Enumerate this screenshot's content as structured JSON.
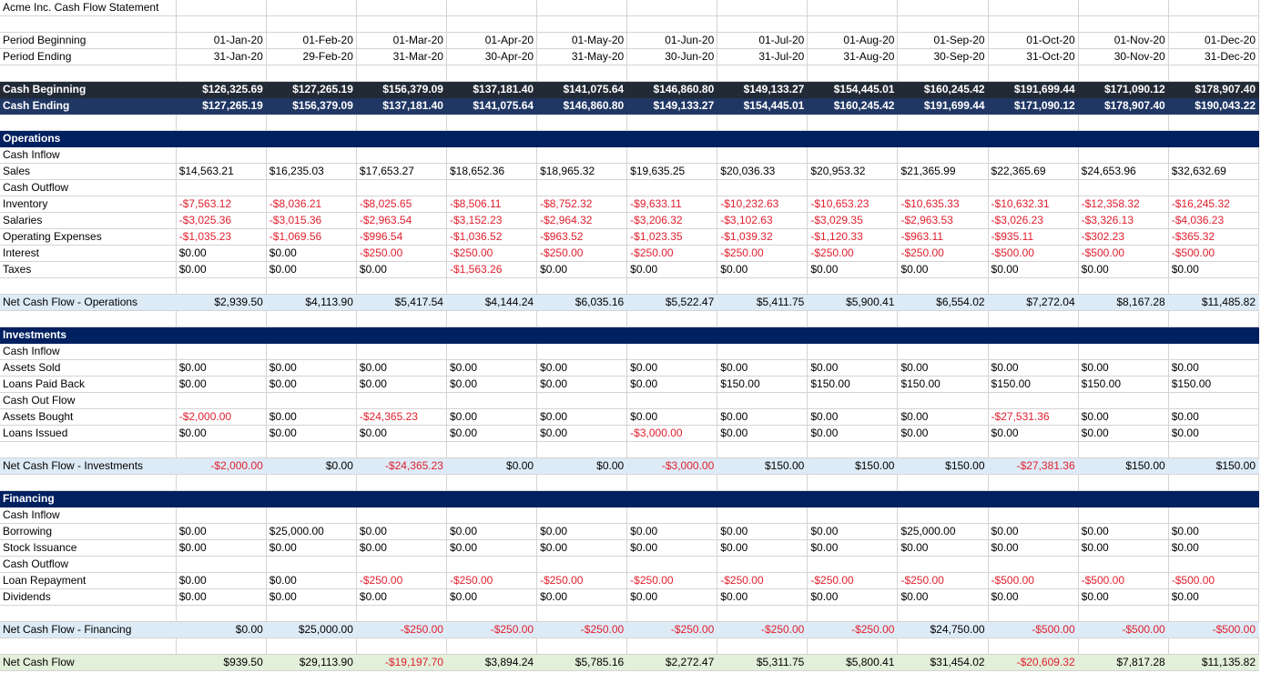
{
  "title": "Acme Inc. Cash Flow Statement",
  "period_beginning_label": "Period Beginning",
  "period_ending_label": "Period Ending",
  "period_beginning": [
    "01-Jan-20",
    "01-Feb-20",
    "01-Mar-20",
    "01-Apr-20",
    "01-May-20",
    "01-Jun-20",
    "01-Jul-20",
    "01-Aug-20",
    "01-Sep-20",
    "01-Oct-20",
    "01-Nov-20",
    "01-Dec-20"
  ],
  "period_ending": [
    "31-Jan-20",
    "29-Feb-20",
    "31-Mar-20",
    "30-Apr-20",
    "31-May-20",
    "30-Jun-20",
    "31-Jul-20",
    "31-Aug-20",
    "30-Sep-20",
    "31-Oct-20",
    "30-Nov-20",
    "31-Dec-20"
  ],
  "cash_beginning": {
    "label": "Cash Beginning",
    "values": [
      "$126,325.69",
      "$127,265.19",
      "$156,379.09",
      "$137,181.40",
      "$141,075.64",
      "$146,860.80",
      "$149,133.27",
      "$154,445.01",
      "$160,245.42",
      "$191,699.44",
      "$171,090.12",
      "$178,907.40"
    ]
  },
  "cash_ending": {
    "label": "Cash Ending",
    "values": [
      "$127,265.19",
      "$156,379.09",
      "$137,181.40",
      "$141,075.64",
      "$146,860.80",
      "$149,133.27",
      "$154,445.01",
      "$160,245.42",
      "$191,699.44",
      "$171,090.12",
      "$178,907.40",
      "$190,043.22"
    ]
  },
  "sections": [
    {
      "name": "Operations",
      "groups": [
        {
          "label": "Cash Inflow",
          "items": [
            {
              "label": "Sales",
              "values": [
                "$14,563.21",
                "$16,235.03",
                "$17,653.27",
                "$18,652.36",
                "$18,965.32",
                "$19,635.25",
                "$20,036.33",
                "$20,953.32",
                "$21,365.99",
                "$22,365.69",
                "$24,653.96",
                "$32,632.69"
              ]
            }
          ]
        },
        {
          "label": "Cash Outflow",
          "items": [
            {
              "label": "Inventory",
              "values": [
                "-$7,563.12",
                "-$8,036.21",
                "-$8,025.65",
                "-$8,506.11",
                "-$8,752.32",
                "-$9,633.11",
                "-$10,232.63",
                "-$10,653.23",
                "-$10,635.33",
                "-$10,632.31",
                "-$12,358.32",
                "-$16,245.32"
              ]
            },
            {
              "label": "Salaries",
              "values": [
                "-$3,025.36",
                "-$3,015.36",
                "-$2,963.54",
                "-$3,152.23",
                "-$2,964.32",
                "-$3,206.32",
                "-$3,102.63",
                "-$3,029.35",
                "-$2,963.53",
                "-$3,026.23",
                "-$3,326.13",
                "-$4,036.23"
              ]
            },
            {
              "label": "Operating Expenses",
              "values": [
                "-$1,035.23",
                "-$1,069.56",
                "-$996.54",
                "-$1,036.52",
                "-$963.52",
                "-$1,023.35",
                "-$1,039.32",
                "-$1,120.33",
                "-$963.11",
                "-$935.11",
                "-$302.23",
                "-$365.32"
              ]
            },
            {
              "label": "Interest",
              "values": [
                "$0.00",
                "$0.00",
                "-$250.00",
                "-$250.00",
                "-$250.00",
                "-$250.00",
                "-$250.00",
                "-$250.00",
                "-$250.00",
                "-$500.00",
                "-$500.00",
                "-$500.00"
              ]
            },
            {
              "label": "Taxes",
              "values": [
                "$0.00",
                "$0.00",
                "$0.00",
                "-$1,563.26",
                "$0.00",
                "$0.00",
                "$0.00",
                "$0.00",
                "$0.00",
                "$0.00",
                "$0.00",
                "$0.00"
              ]
            }
          ]
        }
      ],
      "net": {
        "label": "Net Cash Flow - Operations",
        "values": [
          "$2,939.50",
          "$4,113.90",
          "$5,417.54",
          "$4,144.24",
          "$6,035.16",
          "$5,522.47",
          "$5,411.75",
          "$5,900.41",
          "$6,554.02",
          "$7,272.04",
          "$8,167.28",
          "$11,485.82"
        ]
      }
    },
    {
      "name": "Investments",
      "groups": [
        {
          "label": "Cash Inflow",
          "items": [
            {
              "label": "Assets Sold",
              "values": [
                "$0.00",
                "$0.00",
                "$0.00",
                "$0.00",
                "$0.00",
                "$0.00",
                "$0.00",
                "$0.00",
                "$0.00",
                "$0.00",
                "$0.00",
                "$0.00"
              ]
            },
            {
              "label": "Loans Paid Back",
              "values": [
                "$0.00",
                "$0.00",
                "$0.00",
                "$0.00",
                "$0.00",
                "$0.00",
                "$150.00",
                "$150.00",
                "$150.00",
                "$150.00",
                "$150.00",
                "$150.00"
              ]
            }
          ]
        },
        {
          "label": "Cash Out Flow",
          "items": [
            {
              "label": "Assets Bought",
              "values": [
                "-$2,000.00",
                "$0.00",
                "-$24,365.23",
                "$0.00",
                "$0.00",
                "$0.00",
                "$0.00",
                "$0.00",
                "$0.00",
                "-$27,531.36",
                "$0.00",
                "$0.00"
              ]
            },
            {
              "label": "Loans Issued",
              "values": [
                "$0.00",
                "$0.00",
                "$0.00",
                "$0.00",
                "$0.00",
                "-$3,000.00",
                "$0.00",
                "$0.00",
                "$0.00",
                "$0.00",
                "$0.00",
                "$0.00"
              ]
            }
          ]
        }
      ],
      "net": {
        "label": "Net Cash Flow - Investments",
        "values": [
          "-$2,000.00",
          "$0.00",
          "-$24,365.23",
          "$0.00",
          "$0.00",
          "-$3,000.00",
          "$150.00",
          "$150.00",
          "$150.00",
          "-$27,381.36",
          "$150.00",
          "$150.00"
        ]
      }
    },
    {
      "name": "Financing",
      "groups": [
        {
          "label": "Cash Inflow",
          "items": [
            {
              "label": "Borrowing",
              "values": [
                "$0.00",
                "$25,000.00",
                "$0.00",
                "$0.00",
                "$0.00",
                "$0.00",
                "$0.00",
                "$0.00",
                "$25,000.00",
                "$0.00",
                "$0.00",
                "$0.00"
              ]
            },
            {
              "label": "Stock Issuance",
              "values": [
                "$0.00",
                "$0.00",
                "$0.00",
                "$0.00",
                "$0.00",
                "$0.00",
                "$0.00",
                "$0.00",
                "$0.00",
                "$0.00",
                "$0.00",
                "$0.00"
              ]
            }
          ]
        },
        {
          "label": "Cash Outflow",
          "items": [
            {
              "label": "Loan Repayment",
              "values": [
                "$0.00",
                "$0.00",
                "-$250.00",
                "-$250.00",
                "-$250.00",
                "-$250.00",
                "-$250.00",
                "-$250.00",
                "-$250.00",
                "-$500.00",
                "-$500.00",
                "-$500.00"
              ]
            },
            {
              "label": "Dividends",
              "values": [
                "$0.00",
                "$0.00",
                "$0.00",
                "$0.00",
                "$0.00",
                "$0.00",
                "$0.00",
                "$0.00",
                "$0.00",
                "$0.00",
                "$0.00",
                "$0.00"
              ]
            }
          ]
        }
      ],
      "net": {
        "label": "Net Cash Flow - Financing",
        "values": [
          "$0.00",
          "$25,000.00",
          "-$250.00",
          "-$250.00",
          "-$250.00",
          "-$250.00",
          "-$250.00",
          "-$250.00",
          "$24,750.00",
          "-$500.00",
          "-$500.00",
          "-$500.00"
        ]
      }
    }
  ],
  "net_cash_flow": {
    "label": "Net Cash Flow",
    "values": [
      "$939.50",
      "$29,113.90",
      "-$19,197.70",
      "$3,894.24",
      "$5,785.16",
      "$2,272.47",
      "$5,311.75",
      "$5,800.41",
      "$31,454.02",
      "-$20,609.32",
      "$7,817.28",
      "$11,135.82"
    ]
  },
  "colors": {
    "cash_beginning_bg": "#222a35",
    "cash_ending_bg": "#203764",
    "section_header_bg": "#002060",
    "net_row_bg": "#ddebf7",
    "net_total_bg": "#e2efda",
    "negative_text": "#e0202e"
  }
}
